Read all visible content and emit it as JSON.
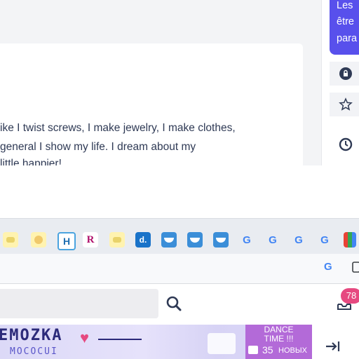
{
  "post": {
    "lines": [
      "ike I twist screws, I make jewelry, I make clothes,",
      " general I show my life. I dream about my",
      "little happier!"
    ]
  },
  "promo": {
    "lines": [
      "Les",
      "être",
      "para"
    ]
  },
  "bookmarks": [
    {
      "icon": "bookmark-favicon-1",
      "label": ""
    },
    {
      "icon": "bookmark-favicon-2",
      "label": ""
    },
    {
      "icon": "bookmark-favicon-3",
      "label": ""
    },
    {
      "icon": "bookmark-favicon-h",
      "label": "H"
    },
    {
      "icon": "bookmark-favicon-r",
      "label": "R"
    },
    {
      "icon": "bookmark-favicon-4",
      "label": ""
    },
    {
      "icon": "bookmark-favicon-d",
      "label": "d."
    },
    {
      "icon": "bookmark-favicon-5",
      "label": ""
    },
    {
      "icon": "bookmark-favicon-6",
      "label": ""
    },
    {
      "icon": "bookmark-favicon-7",
      "label": ""
    },
    {
      "icon": "google-icon",
      "label": "G"
    },
    {
      "icon": "google-icon",
      "label": "G"
    },
    {
      "icon": "google-icon",
      "label": "G"
    },
    {
      "icon": "google-icon",
      "label": "G"
    }
  ],
  "urlbar": {
    "google_label": "G"
  },
  "header": {
    "notification_count": "78"
  },
  "banner": {
    "name": "EMOZKA",
    "sub": "MOCOCUI",
    "dance_line1": "DANCE",
    "dance_line2": "TIME !!!",
    "dance_count": "35",
    "dance_new": "НОВЫХ"
  },
  "colors": {
    "accent": "#5850ec",
    "text": "#2f3a55",
    "badge": "#e64980",
    "dance_bg": "#b36ad8"
  }
}
